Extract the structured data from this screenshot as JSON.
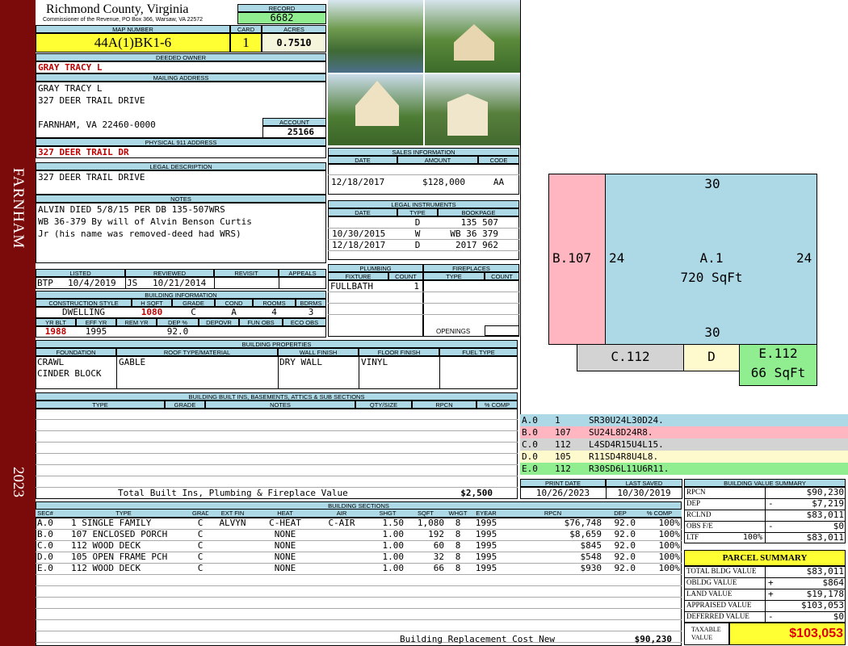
{
  "side": {
    "town": "FARNHAM",
    "year": "2023"
  },
  "header": {
    "county": "Richmond County, Virginia",
    "commissioner": "Commissioner of the Revenue, PO Box 366, Warsaw, VA 22572",
    "record_label": "RECORD",
    "record": "6682",
    "map_label": "MAP NUMBER",
    "map": "44A(1)BK1-6",
    "card_label": "CARD",
    "card": "1",
    "acres_label": "ACRES",
    "acres": "0.7510"
  },
  "owner": {
    "deeded_label": "DEEDED OWNER",
    "deeded": "GRAY TRACY L",
    "mailing_label": "MAILING ADDRESS",
    "mail1": "GRAY TRACY L",
    "mail2": "327 DEER TRAIL DRIVE",
    "mail3": "FARNHAM, VA 22460-0000",
    "account_label": "ACCOUNT",
    "account": "25166",
    "physical_label": "PHYSICAL 911 ADDRESS",
    "physical": "327 DEER TRAIL DR"
  },
  "legal": {
    "label": "LEGAL DESCRIPTION",
    "text": "327 DEER TRAIL DRIVE"
  },
  "notes": {
    "label": "NOTES",
    "l1": "ALVIN DIED 5/8/15 PER DB 135-507WRS",
    "l2": "WB 36-379 By will of Alvin Benson Curtis",
    "l3": "Jr (his name was removed-deed had WRS)"
  },
  "visits": {
    "listed_label": "LISTED",
    "reviewed_label": "REVIEWED",
    "revisit_label": "REVISIT",
    "appeals_label": "APPEALS",
    "listed_by": "BTP",
    "listed": "10/4/2019",
    "reviewed_by": "JS",
    "reviewed": "10/21/2014"
  },
  "bldg_info": {
    "label": "BUILDING INFORMATION",
    "h_cs": "CONSTRUCTION STYLE",
    "h_hsqft": "H SQFT",
    "h_grade": "GRADE",
    "h_cond": "COND",
    "h_rooms": "ROOMS",
    "h_bdrms": "BDRMS",
    "cs": "DWELLING",
    "hsqft": "1080",
    "grade": "C",
    "cond": "A",
    "rooms": "4",
    "bdrms": "3",
    "h_yrblt": "YR BLT",
    "h_effyr": "EFF YR",
    "h_remyr": "REM YR",
    "h_dep": "DEP %",
    "h_depovr": "DEPOVR",
    "h_funobs": "FUN OBS",
    "h_ecoobs": "ECO OBS",
    "yrblt": "1988",
    "effyr": "1995",
    "dep": "92.0"
  },
  "sales": {
    "label": "SALES INFORMATION",
    "h_date": "DATE",
    "h_amount": "AMOUNT",
    "h_code": "CODE",
    "date": "12/18/2017",
    "amount": "$128,000",
    "code": "AA"
  },
  "instruments": {
    "label": "LEGAL INSTRUMENTS",
    "h_date": "DATE",
    "h_type": "TYPE",
    "h_book": "BOOKPAGE",
    "rows": [
      {
        "date": "",
        "type": "D",
        "book": "135 507"
      },
      {
        "date": "10/30/2015",
        "type": "W",
        "book": "WB 36 379"
      },
      {
        "date": "12/18/2017",
        "type": "D",
        "book": "2017 962"
      }
    ]
  },
  "plumbing": {
    "label": "PLUMBING",
    "h_fixture": "FIXTURE",
    "h_count": "COUNT",
    "fixture": "FULLBATH",
    "count": "1"
  },
  "fireplaces": {
    "label": "FIREPLACES",
    "h_type": "TYPE",
    "h_count": "COUNT",
    "openings": "OPENINGS"
  },
  "props": {
    "label": "BUILDING PROPERTIES",
    "h_found": "FOUNDATION",
    "h_roof": "ROOF TYPE/MATERIAL",
    "h_wall": "WALL FINISH",
    "h_floor": "FLOOR FINISH",
    "h_fuel": "FUEL TYPE",
    "found1": "CRAWL",
    "found2": "CINDER BLOCK",
    "roof": "GABLE",
    "wall": "DRY WALL",
    "floor": "VINYL"
  },
  "builtins": {
    "label": "BUILDING BUILT INS, BASEMENTS, ATTICS & SUB SECTIONS",
    "h_type": "TYPE",
    "h_grade": "GRADE",
    "h_notes": "NOTES",
    "h_qty": "QTY/SIZE",
    "h_rpcn": "RPCN",
    "h_comp": "% COMP",
    "total_label": "Total Built Ins, Plumbing & Fireplace Value",
    "total": "$2,500"
  },
  "print": {
    "h_print": "PRINT DATE",
    "h_saved": "LAST SAVED",
    "print": "10/26/2023",
    "saved": "10/30/2019"
  },
  "sketch": {
    "a_top": "30",
    "a_bottom": "30",
    "a_left": "24",
    "a_right": "24",
    "a_label": "A.1",
    "a_area": "720 SqFt",
    "b_label": "B.107",
    "c_label": "C.112",
    "d_label": "D",
    "e_label": "E.112",
    "e_area": "66 SqFt",
    "colors": {
      "a": "#add8e6",
      "b": "#ffb6c1",
      "c": "#d3d3d3",
      "d": "#fffacd",
      "e": "#90ee90"
    }
  },
  "legend": [
    {
      "id": "A.0",
      "code": "1",
      "vec": "SR30U24L30D24."
    },
    {
      "id": "B.0",
      "code": "107",
      "vec": "SU24L8D24R8."
    },
    {
      "id": "C.0",
      "code": "112",
      "vec": "L4SD4R15U4L15."
    },
    {
      "id": "D.0",
      "code": "105",
      "vec": "R11SD4R8U4L8."
    },
    {
      "id": "E.0",
      "code": "112",
      "vec": "R30SD6L11U6R11."
    }
  ],
  "sections": {
    "label": "BUILDING SECTIONS",
    "headers": [
      "SEC#",
      "TYPE",
      "GRADE",
      "EXT FIN",
      "HEAT",
      "AIR",
      "SHGT",
      "SQFT",
      "WHGT",
      "EYEAR",
      "RPCN",
      "DEP",
      "% COMP"
    ],
    "rows": [
      [
        "A.0",
        "1 SINGLE FAMILY",
        "C",
        "ALVYN",
        "C-HEAT",
        "C-AIR",
        "1.50",
        "1,080",
        "8",
        "1995",
        "$76,748",
        "92.0",
        "100%"
      ],
      [
        "B.0",
        "107 ENCLOSED PORCH",
        "C",
        "",
        "NONE",
        "",
        "1.00",
        "192",
        "8",
        "1995",
        "$8,659",
        "92.0",
        "100%"
      ],
      [
        "C.0",
        "112 WOOD DECK",
        "C",
        "",
        "NONE",
        "",
        "1.00",
        "60",
        "8",
        "1995",
        "$845",
        "92.0",
        "100%"
      ],
      [
        "D.0",
        "105 OPEN FRAME PCH",
        "C",
        "",
        "NONE",
        "",
        "1.00",
        "32",
        "8",
        "1995",
        "$548",
        "92.0",
        "100%"
      ],
      [
        "E.0",
        "112 WOOD DECK",
        "C",
        "",
        "NONE",
        "",
        "1.00",
        "66",
        "8",
        "1995",
        "$930",
        "92.0",
        "100%"
      ]
    ],
    "brcn_label": "Building Replacement Cost New",
    "brcn": "$90,230"
  },
  "bvs": {
    "label": "BUILDING VALUE SUMMARY",
    "rows": [
      {
        "k": "RPCN",
        "s": "",
        "v": "$90,230"
      },
      {
        "k": "DEP",
        "s": "-",
        "v": "$7,219"
      },
      {
        "k": "RCLND",
        "s": "",
        "v": "$83,011"
      },
      {
        "k": "OBS F/E",
        "s": "-",
        "v": "$0"
      },
      {
        "k": "LTF",
        "p": "100%",
        "s": "",
        "v": "$83,011"
      }
    ]
  },
  "parcel": {
    "label": "PARCEL SUMMARY",
    "rows": [
      {
        "k": "TOTAL BLDG VALUE",
        "s": "",
        "v": "$83,011"
      },
      {
        "k": "OBLDG VALUE",
        "s": "+",
        "v": "$864"
      },
      {
        "k": "LAND VALUE",
        "s": "+",
        "v": "$19,178"
      },
      {
        "k": "APPRAISED VALUE",
        "s": "",
        "v": "$103,053"
      },
      {
        "k": "DEFERRED VALUE",
        "s": "-",
        "v": "$0"
      }
    ],
    "taxable_label": "TAXABLE VALUE",
    "taxable": "$103,053"
  }
}
